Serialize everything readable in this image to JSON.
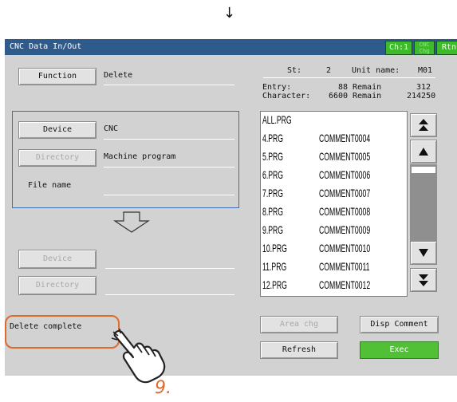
{
  "top_arrow": "↓",
  "window": {
    "title": "CNC Data In/Out",
    "ch_label": "Ch:1",
    "cnc_chg_label": "CNC Chg",
    "rtn_label": "Rtn"
  },
  "function": {
    "button_label": "Function",
    "value": "Delete"
  },
  "status": {
    "st_label": "St:",
    "st_value": "2",
    "unit_label": "Unit name:",
    "unit_value": "M01",
    "entry_label": "Entry:",
    "entry_value": "88",
    "entry_remain_label": "Remain",
    "entry_remain_value": "312",
    "char_label": "Character:",
    "char_value": "6600",
    "char_remain_label": "Remain",
    "char_remain_value": "214250"
  },
  "source": {
    "device_button": "Device",
    "device_value": "CNC",
    "directory_button": "Directory",
    "directory_value": "Machine program",
    "file_name_label": "File name",
    "file_name_value": ""
  },
  "transfer_arrow": "⇩",
  "destination": {
    "device_button": "Device",
    "device_value": "",
    "directory_button": "Directory",
    "directory_value": ""
  },
  "file_list": [
    {
      "name": "ALL.PRG",
      "comment": ""
    },
    {
      "name": "4.PRG",
      "comment": "COMMENT0004"
    },
    {
      "name": "5.PRG",
      "comment": "COMMENT0005"
    },
    {
      "name": "6.PRG",
      "comment": "COMMENT0006"
    },
    {
      "name": "7.PRG",
      "comment": "COMMENT0007"
    },
    {
      "name": "8.PRG",
      "comment": "COMMENT0008"
    },
    {
      "name": "9.PRG",
      "comment": "COMMENT0009"
    },
    {
      "name": "10.PRG",
      "comment": "COMMENT0010"
    },
    {
      "name": "11.PRG",
      "comment": "COMMENT0011"
    },
    {
      "name": "12.PRG",
      "comment": "COMMENT0012"
    }
  ],
  "scrollbar": {
    "top_icon": "double-up-arrow-icon",
    "up_icon": "up-arrow-icon",
    "down_icon": "down-arrow-icon",
    "bottom_icon": "double-down-arrow-icon"
  },
  "buttons": {
    "area_chg": "Area chg",
    "disp_comment": "Disp Comment",
    "refresh": "Refresh",
    "exec": "Exec"
  },
  "message": "Delete complete",
  "step_number": "9.",
  "colors": {
    "title_bar": "#2f5b8c",
    "ch_green": "#3dbb2b",
    "exec_green": "#52c036",
    "highlight_orange": "#e06a2a",
    "source_frame": "#3e6fb4"
  }
}
